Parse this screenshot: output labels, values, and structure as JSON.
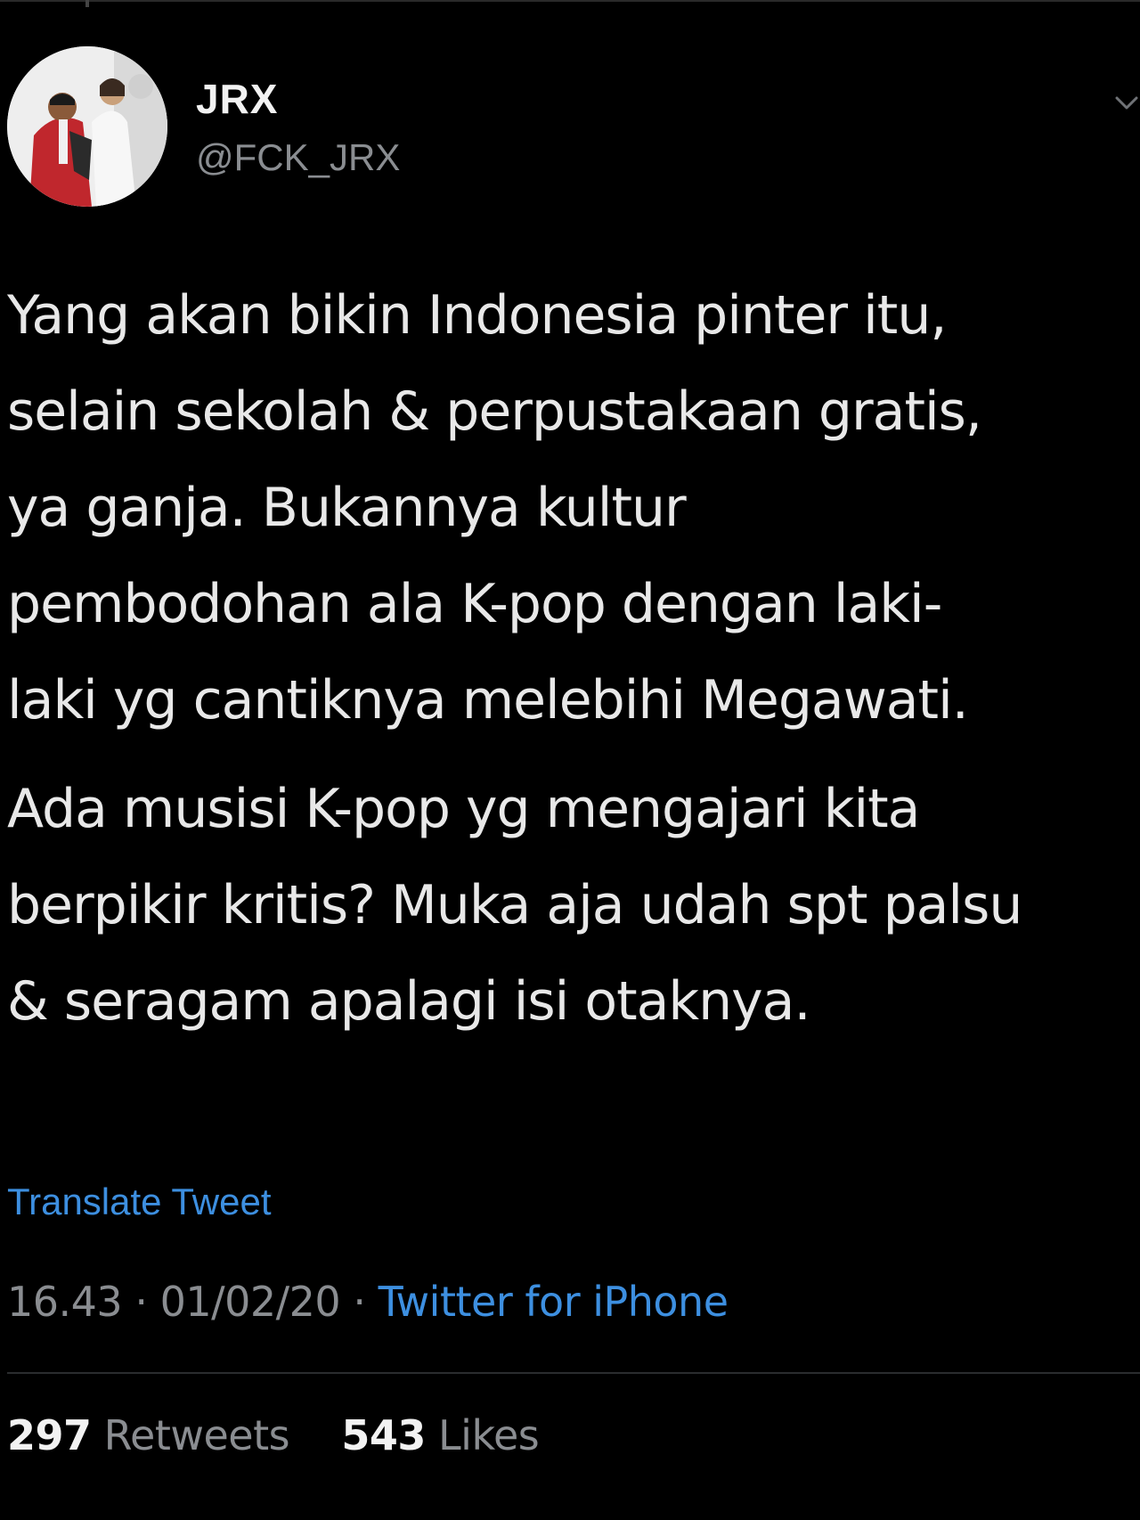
{
  "tweet": {
    "author": {
      "display_name": "JRX",
      "handle": "@FCK_JRX"
    },
    "text_paragraphs": [
      [
        "Yang akan bikin Indonesia pinter itu,",
        "selain sekolah & perpustakaan gratis,",
        "ya ganja. Bukannya kultur",
        "pembodohan ala K-pop dengan laki-",
        "laki yg cantiknya melebihi Megawati."
      ],
      [
        "Ada musisi K-pop yg mengajari kita",
        "berpikir kritis? Muka aja udah spt palsu",
        "& seragam apalagi isi otaknya."
      ]
    ],
    "translate_label": "Translate Tweet",
    "time": "16.43",
    "date": "01/02/20",
    "separator": "·",
    "source": "Twitter for iPhone",
    "retweets_count": "297",
    "retweets_label": "Retweets",
    "likes_count": "543",
    "likes_label": "Likes"
  },
  "icons": {
    "menu": "chevron-down-icon"
  },
  "colors": {
    "background": "#000000",
    "text": "#e8e8e8",
    "muted": "#8a8d91",
    "link": "#3d8fe0"
  }
}
